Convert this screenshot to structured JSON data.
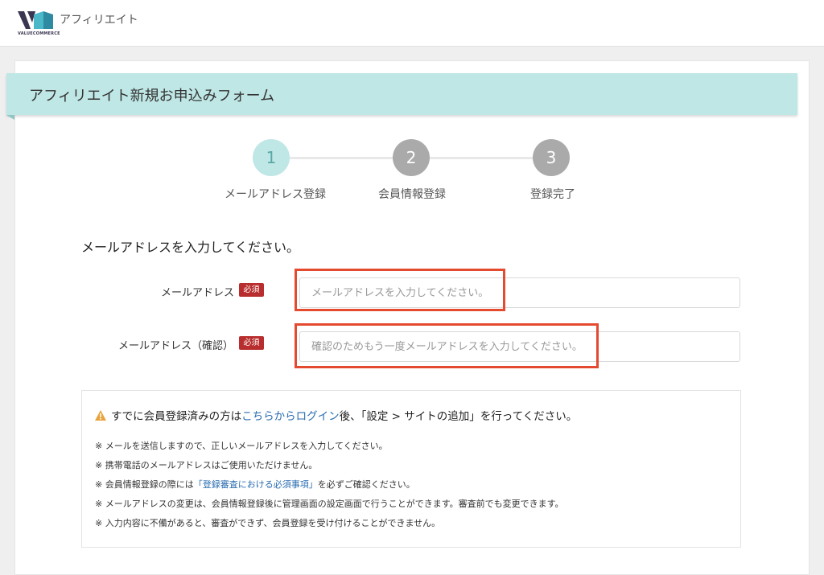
{
  "header": {
    "brand": "アフィリエイト",
    "logo_text": "VALUECOMMERCE"
  },
  "page": {
    "title": "アフィリエイト新規お申込みフォーム"
  },
  "steps": [
    {
      "number": "1",
      "label": "メールアドレス登録",
      "state": "active"
    },
    {
      "number": "2",
      "label": "会員情報登録",
      "state": "inactive"
    },
    {
      "number": "3",
      "label": "登録完了",
      "state": "inactive"
    }
  ],
  "colors": {
    "step_active": "#bfe7e5",
    "step_inactive": "#aaaaaa",
    "required_badge": "#b82d2d",
    "highlight": "#e44a2f",
    "link": "#2a6cb0",
    "banner": "#bfe7e5"
  },
  "form": {
    "instruction": "メールアドレスを入力してください。",
    "email": {
      "label": "メールアドレス",
      "required": "必須",
      "placeholder": "メールアドレスを入力してください。",
      "value": ""
    },
    "email_confirm": {
      "label": "メールアドレス（確認）",
      "required": "必須",
      "placeholder": "確認のためもう一度メールアドレスを入力してください。",
      "value": ""
    }
  },
  "notice": {
    "icon": "warning-icon",
    "head_before": "すでに会員登録済みの方は",
    "head_link": "こちらからログイン",
    "head_after": "後、「設定 > サイトの追加」を行ってください。",
    "notes": [
      {
        "before": "※ メールを送信しますので、正しいメールアドレスを入力してください。",
        "link": "",
        "after": ""
      },
      {
        "before": "※ 携帯電話のメールアドレスはご使用いただけません。",
        "link": "",
        "after": ""
      },
      {
        "before": "※ 会員情報登録の際には",
        "link": "「登録審査における必須事項」",
        "after": "を必ずご確認ください。"
      },
      {
        "before": "※ メールアドレスの変更は、会員情報登録後に管理画面の設定画面で行うことができます。審査前でも変更できます。",
        "link": "",
        "after": ""
      },
      {
        "before": "※ 入力内容に不備があると、審査ができず、会員登録を受け付けることができません。",
        "link": "",
        "after": ""
      }
    ]
  }
}
